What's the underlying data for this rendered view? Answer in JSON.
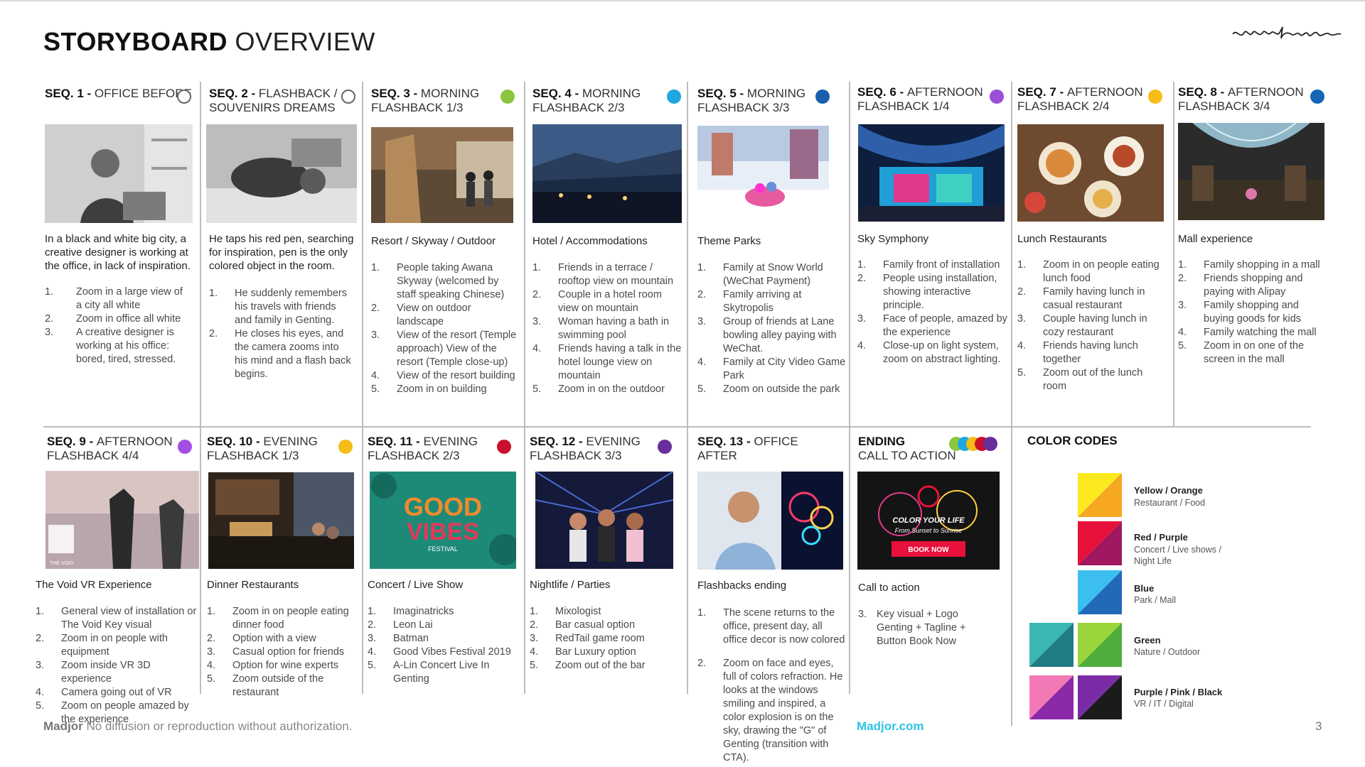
{
  "page": {
    "title_bold": "STORYBOARD",
    "title_light": " OVERVIEW",
    "logo_text": "madjor",
    "footer_brand": "Madjor",
    "footer_notice": " No diffusion or reproduction without authorization.",
    "footer_site": "Madjor.com",
    "page_number": "3"
  },
  "sequences": [
    {
      "bold": "SEQ. 1 - ",
      "head_rest": "OFFICE BEFORE",
      "line2": "",
      "dot": "outline",
      "color": "#ffffff",
      "caption": "In a black and white big city, a creative designer is working at the office, in lack of inspiration.",
      "items": [
        "Zoom in a large view of a city all white",
        "Zoom in office all white",
        "A creative designer is working at his office: bored, tired, stressed."
      ]
    },
    {
      "bold": "SEQ. 2 - ",
      "head_rest": "FLASHBACK /",
      "line2": "SOUVENIRS DREAMS",
      "dot": "outline",
      "color": "#ffffff",
      "caption": "He taps his red pen, searching for inspiration, pen is the only colored object in the room.",
      "items": [
        "He suddenly remembers his travels with friends and family in Genting.",
        "He closes his eyes, and the camera zooms into his mind and a flash back begins."
      ]
    },
    {
      "bold": "SEQ. 3 - ",
      "head_rest": "MORNING",
      "line2": "FLASHBACK 1/3",
      "dot": "fill",
      "color": "#8cc63f",
      "caption": "Resort / Skyway / Outdoor",
      "items": [
        "People taking Awana Skyway (welcomed by staff speaking Chinese)",
        "View on outdoor landscape",
        "View of the resort (Temple approach) View of the resort (Temple close-up)",
        "View of the resort building",
        "Zoom in on building"
      ]
    },
    {
      "bold": "SEQ. 4 - ",
      "head_rest": "MORNING",
      "line2": "FLASHBACK 2/3",
      "dot": "fill",
      "color": "#1ea7e1",
      "caption": "Hotel / Accommodations",
      "items": [
        "Friends in a terrace / rooftop view on mountain",
        "Couple in a hotel room view on mountain",
        "Woman having a bath in swimming pool",
        "Friends having a talk in the hotel lounge view on mountain",
        "Zoom in on the outdoor"
      ]
    },
    {
      "bold": "SEQ. 5 - ",
      "head_rest": "MORNING",
      "line2": "FLASHBACK 3/3",
      "dot": "fill",
      "color": "#1a5fad",
      "caption": "Theme Parks",
      "items": [
        "Family at Snow World (WeChat Payment)",
        "Family arriving at Skytropolis",
        "Group of friends at Lane bowling alley paying with WeChat.",
        "Family at City Video Game Park",
        "Zoom on outside the park"
      ]
    },
    {
      "bold": "SEQ. 6 - ",
      "head_rest": "AFTERNOON",
      "line2": "FLASHBACK 1/4",
      "dot": "fill",
      "color": "#9b4fd6",
      "caption": "Sky Symphony",
      "items": [
        "Family front of installation",
        "People using installation, showing interactive principle.",
        "Face of people, amazed by the experience",
        "Close-up on light system, zoom on abstract lighting."
      ]
    },
    {
      "bold": "SEQ. 7 - ",
      "head_rest": "AFTERNOON",
      "line2": "FLASHBACK 2/4",
      "dot": "fill",
      "color": "#f6bd16",
      "caption": "Lunch Restaurants",
      "items": [
        "Zoom in on people eating lunch food",
        "Family having lunch in casual restaurant",
        "Couple having lunch in cozy restaurant",
        "Friends having lunch together",
        "Zoom out of the lunch room"
      ]
    },
    {
      "bold": "SEQ. 8 - ",
      "head_rest": "AFTERNOON",
      "line2": "FLASHBACK 3/4",
      "dot": "fill",
      "color": "#1565b8",
      "caption": "Mall experience",
      "items": [
        "Family shopping in a mall",
        "Friends shopping and paying with Alipay",
        "Family shopping and buying goods for kids",
        "Family watching the mall",
        "Zoom in on one of the screen in the mall"
      ]
    },
    {
      "bold": "SEQ. 9 - ",
      "head_rest": "AFTERNOON",
      "line2": "FLASHBACK 4/4",
      "dot": "fill",
      "color": "#a34ee3",
      "caption": "The Void VR Experience",
      "items": [
        "General view of installation or The Void Key visual",
        "Zoom in on people with equipment",
        "Zoom inside VR 3D experience",
        "Camera going out of VR",
        "Zoom on people amazed by the experience"
      ]
    },
    {
      "bold": "SEQ. 10 - ",
      "head_rest": "EVENING",
      "line2": "FLASHBACK 1/3",
      "dot": "fill",
      "color": "#f6bd16",
      "caption": "Dinner Restaurants",
      "items": [
        "Zoom in on people eating dinner food",
        "Option with a view",
        "Casual option for friends",
        "Option for wine experts",
        "Zoom outside of the restaurant"
      ]
    },
    {
      "bold": "SEQ. 11 - ",
      "head_rest": "EVENING",
      "line2": "FLASHBACK 2/3",
      "dot": "fill",
      "color": "#c8102e",
      "caption": "Concert / Live Show",
      "items": [
        "Imaginatricks",
        "Leon Lai",
        "Batman",
        "Good Vibes Festival 2019",
        "A-Lin Concert Live In Genting"
      ]
    },
    {
      "bold": "SEQ. 12 - ",
      "head_rest": "EVENING",
      "line2": "FLASHBACK 3/3",
      "dot": "fill",
      "color": "#6a2e9c",
      "caption": "Nightlife / Parties",
      "items": [
        "Mixologist",
        "Bar casual option",
        "RedTail game room",
        "Bar Luxury option",
        "Zoom out of the bar"
      ]
    },
    {
      "bold": "SEQ. 13 - ",
      "head_rest": "OFFICE",
      "line2": "AFTER",
      "dot": "none",
      "color": "#ffffff",
      "caption": "Flashbacks ending",
      "items": [
        "The scene returns to the office, present day, all office decor is now colored",
        "Zoom on face and eyes, full of colors refraction. He looks at the windows smiling and inspired, a color explosion is on the sky, drawing the \"G\" of Genting (transition with CTA)."
      ]
    },
    {
      "bold": "ENDING",
      "head_rest": "",
      "line2": "CALL TO ACTION",
      "dot": "multi",
      "color": "#ffffff",
      "caption": "Call to action",
      "items": [
        "Key visual + Logo Genting + Tagline + Button Book Now"
      ]
    }
  ],
  "item_numbers": {
    "s1": [
      "1.",
      "2.",
      "3."
    ],
    "s2": [
      "1.",
      "2."
    ],
    "s13": [
      "1.",
      "2."
    ],
    "s14": [
      "3."
    ]
  },
  "thumb_text": {
    "good_vibes_1": "GOOD",
    "good_vibes_2": "VIBES",
    "good_vibes_3": "FESTIVAL",
    "void_logo": "THE VOID",
    "cta_title": "COLOR YOUR LIFE",
    "cta_tagline": "From Sunset to Sunrise",
    "cta_button": "BOOK NOW"
  },
  "color_codes": {
    "title": "COLOR CODES",
    "entries": [
      {
        "name": "Yellow / Orange",
        "desc": "Restaurant / Food",
        "c1": "#fbe91f",
        "c2": "#f7a823"
      },
      {
        "name": "Red / Purple",
        "desc": "Concert / Live shows / Night Life",
        "c1": "#e8113b",
        "c2": "#a0185f"
      },
      {
        "name": "Blue",
        "desc": "Park / Mall",
        "c1": "#3cbfef",
        "c2": "#2168b9"
      },
      {
        "name": "Green",
        "desc": "Nature / Outdoor",
        "c1": "#9bd43b",
        "c2": "#4fae3b",
        "c3": "#3ab6b3",
        "c4": "#217c86"
      },
      {
        "name": "Purple / Pink / Black",
        "desc": "VR / IT / Digital",
        "c1": "#f278b6",
        "c2": "#8a2aa8",
        "c3": "#7a2ca6",
        "c4": "#1b1b1b"
      }
    ]
  }
}
